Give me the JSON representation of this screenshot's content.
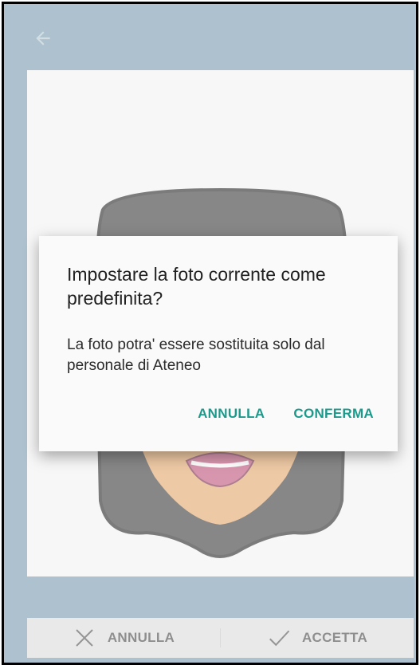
{
  "toolbar": {
    "back_icon": "arrow-back-icon"
  },
  "photo": {
    "avatar_icon": "avatar-woman-icon"
  },
  "bottom_bar": {
    "cancel_label": "ANNULLA",
    "cancel_icon": "close-icon",
    "accept_label": "ACCETTA",
    "accept_icon": "check-icon"
  },
  "dialog": {
    "title": "Impostare la foto corrente come predefinita?",
    "message": "La foto potra' essere sostituita solo dal personale di Ateneo",
    "cancel_label": "ANNULLA",
    "confirm_label": "CONFERMA"
  },
  "colors": {
    "background": "#7b9db0",
    "accent": "#1b9a8c",
    "dialog_bg": "#fafafa"
  }
}
